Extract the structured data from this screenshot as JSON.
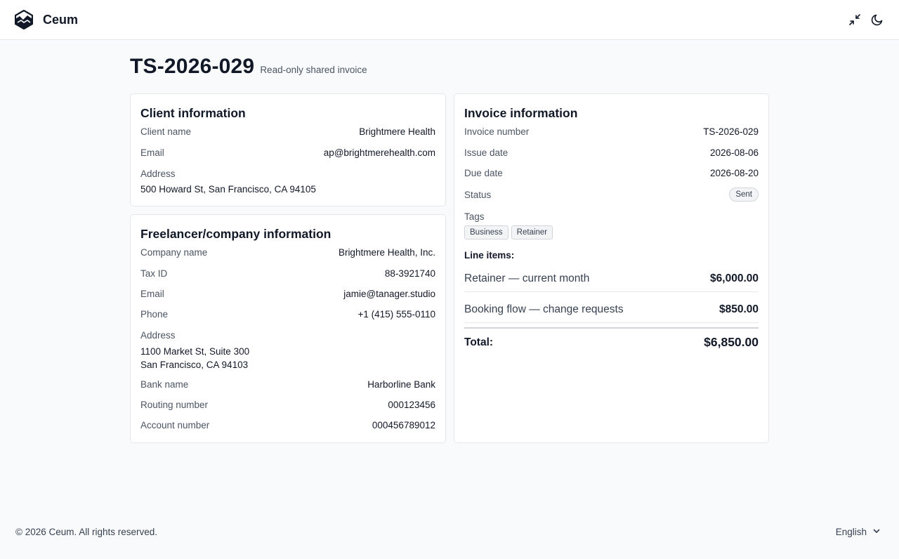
{
  "app": {
    "name": "Ceum",
    "logo_icon": "ceum-logo-icon",
    "actions": [
      {
        "icon": "minimize-icon"
      },
      {
        "icon": "moon-icon"
      }
    ]
  },
  "page": {
    "title": "TS-2026-029",
    "subtitle": "Read-only shared invoice"
  },
  "client": {
    "heading": "Client information",
    "name_label": "Client name",
    "name": "Brightmere Health",
    "email_label": "Email",
    "email": "ap@brightmerehealth.com",
    "address_label": "Address",
    "address": "500 Howard St, San Francisco, CA 94105"
  },
  "freelancer": {
    "heading": "Freelancer/company information",
    "company_label": "Company name",
    "company": "Brightmere Health, Inc.",
    "tax_label": "Tax ID",
    "tax": "88-3921740",
    "email_label": "Email",
    "email": "jamie@tanager.studio",
    "phone_label": "Phone",
    "phone": "+1 (415) 555-0110",
    "address_label": "Address",
    "address_line1": "1100 Market St, Suite 300",
    "address_line2": "San Francisco, CA 94103",
    "bank_label": "Bank name",
    "bank": "Harborline Bank",
    "routing_label": "Routing number",
    "routing": "000123456",
    "account_label": "Account number",
    "account": "000456789012"
  },
  "invoice": {
    "heading": "Invoice information",
    "number_label": "Invoice number",
    "number": "TS-2026-029",
    "issue_label": "Issue date",
    "issue": "2026-08-06",
    "due_label": "Due date",
    "due": "2026-08-20",
    "status_label": "Status",
    "status": "Sent",
    "tags_label": "Tags",
    "tags": [
      "Business",
      "Retainer"
    ],
    "line_items_label": "Line items:",
    "line_items": [
      {
        "description": "Retainer — current month",
        "amount": "$6,000.00"
      },
      {
        "description": "Booking flow — change requests",
        "amount": "$850.00"
      }
    ],
    "total_label": "Total:",
    "total": "$6,850.00"
  },
  "footer": {
    "copyright": "© 2026 Ceum. All rights reserved.",
    "language": "English"
  }
}
